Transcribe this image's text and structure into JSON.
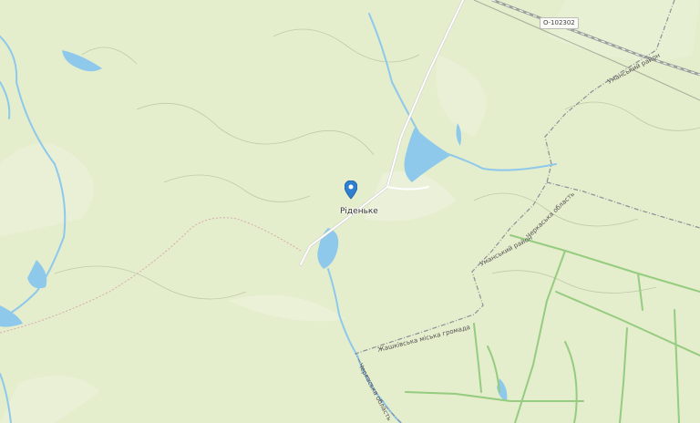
{
  "map": {
    "place": {
      "name": "Ріденьке",
      "marker": "map-pin-icon",
      "marker_color": "#2f7fd0"
    },
    "road_ref": "О-102302",
    "boundary_labels": {
      "upper_right": "Уманський район",
      "center_right": "Черкаська область",
      "right_mid": "Уманський район",
      "bottom_center": "Жашківська міська громада",
      "bottom_left": "Черкаська область"
    },
    "colors": {
      "background": "#e4edcc",
      "water": "#8ec9ec",
      "forest_track": "#95cc7f",
      "boundary": "#8a8f98",
      "road": "#ffffff"
    }
  }
}
